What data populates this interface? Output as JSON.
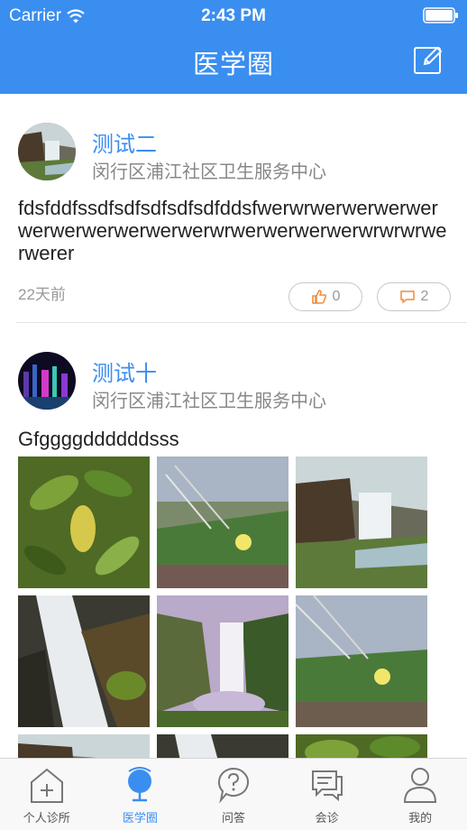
{
  "status": {
    "carrier": "Carrier",
    "time": "2:43 PM"
  },
  "nav": {
    "title": "医学圈"
  },
  "posts": [
    {
      "name": "测试二",
      "org": "闵行区浦江社区卫生服务中心",
      "content": "fdsfddfssdfsdfsdfsdfsdfddsfwerwrwerwerwerwerwerwerwerwerwerwerwrwerwerwerwerwrwrwrwerwerer",
      "time": "22天前",
      "likes": "0",
      "comments": "2"
    },
    {
      "name": "测试十",
      "org": "闵行区浦江社区卫生服务中心",
      "content": "Gfggggddddddsss"
    }
  ],
  "tabs": [
    {
      "label": "个人诊所",
      "icon": "house-plus-icon"
    },
    {
      "label": "医学圈",
      "icon": "globe-icon"
    },
    {
      "label": "问答",
      "icon": "question-bubble-icon"
    },
    {
      "label": "会诊",
      "icon": "chat-bubbles-icon"
    },
    {
      "label": "我的",
      "icon": "person-icon"
    }
  ],
  "colors": {
    "accent": "#3a8ef0",
    "active_tab": "#3a8ef0",
    "like_icon": "#f08a3a",
    "comment_icon": "#f08a3a"
  }
}
